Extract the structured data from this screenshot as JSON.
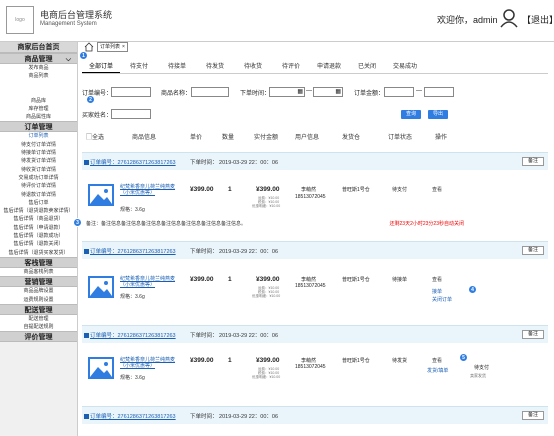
{
  "header": {
    "logo_text": "logo",
    "title": "电商后台管理系统",
    "subtitle": "Management System",
    "welcome": "欢迎你，admin",
    "logout": "【退出】"
  },
  "sidebar": {
    "home": "商家后台首页",
    "sections": [
      {
        "title": "商品管理",
        "items": [
          "发布商品",
          "商品列表",
          "",
          "",
          "商品库",
          "库存管理",
          "商品属性库"
        ]
      },
      {
        "title": "订单管理",
        "items": [
          "订单列表",
          "待支付订单详情",
          "待接单订单详情",
          "待发货订单详情",
          "待收货订单详情",
          "交易成功订单详情",
          "待评价订单详情",
          "待退款订单详情",
          "售后订单",
          "售后详情（退货退款卖家详情）",
          "售后详情（商品退货）",
          "售后详情（申请退款）",
          "售后详情（退款成功）",
          "售后详情（退款关闭）",
          "售后详情（退货买家发货）"
        ]
      },
      {
        "title": "客栈管理",
        "items": [
          "商品客栈列表"
        ]
      },
      {
        "title": "营销管理",
        "items": [
          "商品品牌设置",
          "运费规则设置"
        ]
      },
      {
        "title": "配送管理",
        "items": [
          "配送管理",
          "自提配送规则"
        ]
      },
      {
        "title": "评价管理",
        "items": []
      }
    ]
  },
  "breadcrumb": {
    "tab": "订单列表",
    "close": "×"
  },
  "tabs": [
    "全部订单",
    "待支付",
    "待接单",
    "待发货",
    "待收货",
    "待评价",
    "申请退款",
    "已关闭",
    "交易成功"
  ],
  "filters": {
    "order_no": "订单编号：",
    "product": "商品名称：",
    "order_time": "下单时间：",
    "amount": "订单金额：",
    "buyer": "买家姓名：",
    "dash": "—",
    "search": "查询",
    "export": "导出"
  },
  "table_headers": [
    "全选",
    "商品信息",
    "单价",
    "数量",
    "实付金额",
    "用户信息",
    "发货仓",
    "订单状态",
    "操作"
  ],
  "orders": [
    {
      "no": "订单编号：276128637126381726​3",
      "time": "下单时间：  2019-03-29  22：00：06",
      "note": "备注",
      "product": "纪梵希香奈儿荷兰纯燕麦（小米优惠等）",
      "spec": "规格：3.6g",
      "price": "¥399.00",
      "qty": "1",
      "paid": "¥399.00",
      "fee1": "运费：¥10.00",
      "fee2": "税费：¥10.00",
      "fee3": "优惠明细：¥10.00",
      "user": "李萌然",
      "phone": "18513072045",
      "warehouse": "普旺斯1号仓",
      "status": "待支付",
      "ops": [
        "查看"
      ]
    },
    {
      "no": "订单编号：2761286371263817263",
      "time": "下单时间：  2019-03-29  22：00：06",
      "note": "备注",
      "product": "纪梵希香奈儿荷兰纯燕麦（小米优惠等）",
      "spec": "规格：3.6g",
      "price": "¥399.00",
      "qty": "1",
      "paid": "¥399.00",
      "fee1": "运费：¥10.00",
      "fee2": "税费：¥10.00",
      "fee3": "优惠明细：¥10.00",
      "user": "李萌然",
      "phone": "18513072045",
      "warehouse": "普旺斯1号仓",
      "status": "待接单",
      "ops": [
        "查看",
        "接单",
        "关闭订单"
      ]
    },
    {
      "no": "订单编号：2761286371263817263",
      "time": "下单时间：  2019-03-29  22：00：06",
      "note": "备注",
      "product": "纪梵希香奈儿荷兰纯燕麦（小米优惠等）",
      "spec": "规格：3.6g",
      "price": "¥399.00",
      "qty": "1",
      "paid": "¥399.00",
      "fee1": "运费：¥10.00",
      "fee2": "税费：¥10.00",
      "fee3": "优惠明细：¥10.00",
      "user": "李萌然",
      "phone": "18513072045",
      "warehouse": "普旺斯1号仓",
      "status": "待发货",
      "ops": [
        "查看",
        "发货/填单"
      ]
    },
    {
      "no": "订单编号：2761286371263817263",
      "time": "下单时间：  2019-03-29  22：00：06",
      "note": "备注"
    }
  ],
  "remark": "备注：备注信息备注信息备注信息备注信息备注信息备注信息备注信息。",
  "remark_red": "还剩23天2小时23分23秒自动关闭",
  "side_status": {
    "a": "待支付",
    "b": "卖家发货"
  },
  "badges": [
    "1",
    "2",
    "3",
    "4",
    "5"
  ]
}
